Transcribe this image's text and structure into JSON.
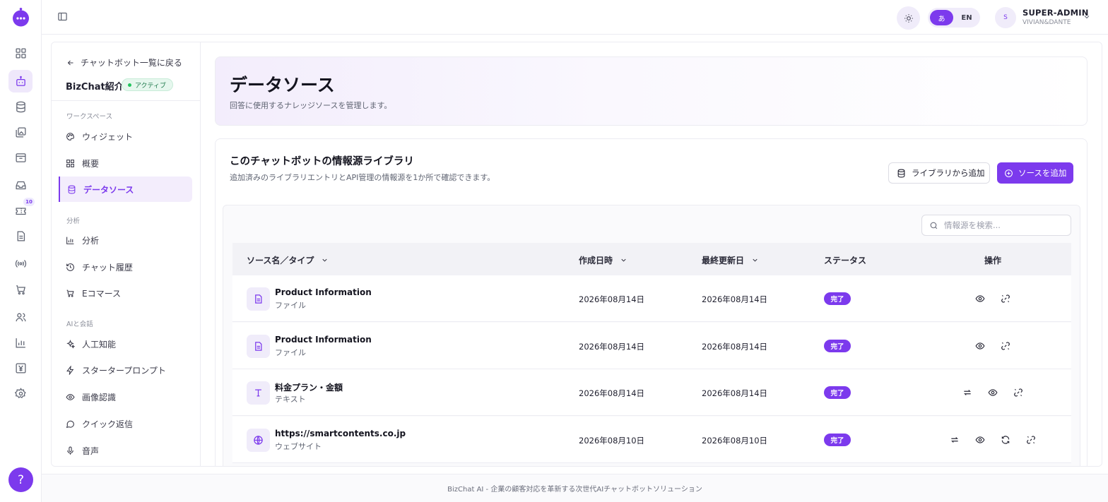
{
  "topbar": {
    "lang_ja": "あ",
    "lang_en": "EN",
    "user_initial": "S",
    "user_name": "SUPER-ADMIN",
    "user_org": "VIVIAN&DANTE"
  },
  "rail": {
    "ticket_badge": "10",
    "help_label": "?"
  },
  "subnav": {
    "back_label": "チャットボット一覧に戻る",
    "bot_name": "BizChat紹介",
    "bot_status": "アクティブ",
    "sections": [
      {
        "label": "ワークスペース",
        "items": [
          "ウィジェット",
          "概要",
          "データソース"
        ]
      },
      {
        "label": "分析",
        "items": [
          "分析",
          "チャット履歴",
          "Eコマース"
        ]
      },
      {
        "label": "AIと会話",
        "items": [
          "人工知能",
          "スタータープロンプト",
          "画像認識",
          "クイック返信",
          "音声"
        ]
      }
    ]
  },
  "hero": {
    "title": "データソース",
    "description": "回答に使用するナレッジソースを管理します。"
  },
  "library": {
    "title": "このチャットボットの情報源ライブラリ",
    "description": "追加済みのライブラリエントリとAPI管理の情報源を1か所で確認できます。",
    "add_from_library": "ライブラリから追加",
    "add_source": "ソースを追加",
    "search_placeholder": "情報源を検索...",
    "columns": {
      "name_type": "ソース名／タイプ",
      "created": "作成日時",
      "updated": "最終更新日",
      "status": "ステータス",
      "actions": "操作"
    },
    "rows": [
      {
        "name": "Product Information",
        "type": "ファイル",
        "created": "2026年08月14日",
        "updated": "2026年08月14日",
        "status": "完了",
        "icon": "file-icon"
      },
      {
        "name": "Product Information",
        "type": "ファイル",
        "created": "2026年08月14日",
        "updated": "2026年08月14日",
        "status": "完了",
        "icon": "file-icon"
      },
      {
        "name": "料金プラン・金額",
        "type": "テキスト",
        "created": "2026年08月14日",
        "updated": "2026年08月14日",
        "status": "完了",
        "icon": "text-icon"
      },
      {
        "name": "https://smartcontents.co.jp",
        "type": "ウェブサイト",
        "created": "2026年08月10日",
        "updated": "2026年08月10日",
        "status": "完了",
        "icon": "globe-icon"
      }
    ]
  },
  "footer": {
    "text": "BizChat AI - 企業の顧客対応を革新する次世代AIチャットボットソリューション"
  },
  "colors": {
    "accent": "#7c3aed",
    "accent_light": "#f0ecfa",
    "success": "#22c55e"
  }
}
